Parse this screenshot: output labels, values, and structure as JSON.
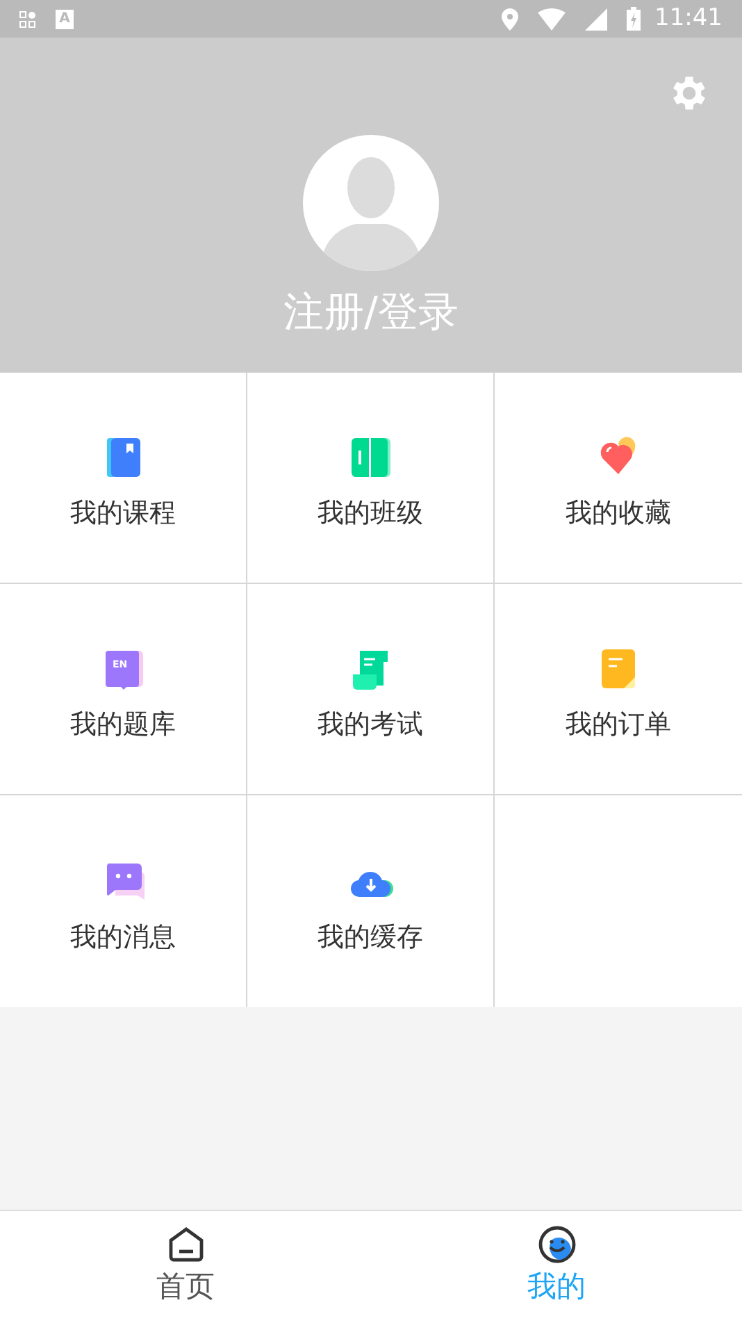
{
  "status_bar": {
    "notification_letter": "A",
    "time": "11:41"
  },
  "profile": {
    "login_label": "注册/登录"
  },
  "menu": [
    {
      "kind": "course",
      "label": "我的课程"
    },
    {
      "kind": "class",
      "label": "我的班级"
    },
    {
      "kind": "favorite",
      "label": "我的收藏"
    },
    {
      "kind": "bank",
      "label": "我的题库",
      "icon_text": "EN"
    },
    {
      "kind": "exam",
      "label": "我的考试"
    },
    {
      "kind": "order",
      "label": "我的订单"
    },
    {
      "kind": "message",
      "label": "我的消息"
    },
    {
      "kind": "cache",
      "label": "我的缓存"
    }
  ],
  "tabs": [
    {
      "kind": "home",
      "label": "首页",
      "selected": false
    },
    {
      "kind": "me",
      "label": "我的",
      "selected": true
    }
  ]
}
